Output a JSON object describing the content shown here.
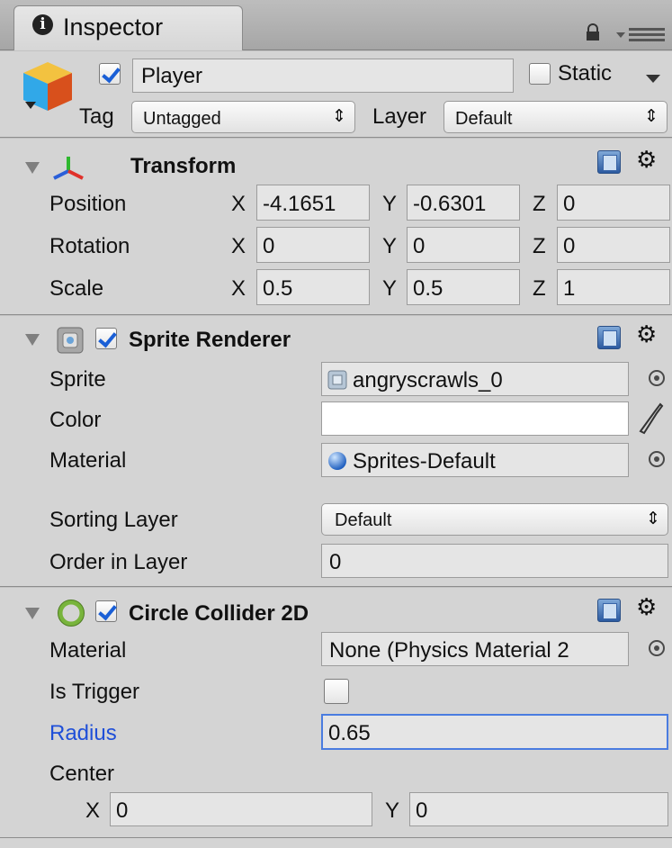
{
  "tab": {
    "title": "Inspector",
    "info_glyph": "i"
  },
  "header": {
    "icon": "cube-icon",
    "name": "Player",
    "active": true,
    "static_label": "Static",
    "static_checked": false,
    "tag_label": "Tag",
    "tag_value": "Untagged",
    "layer_label": "Layer",
    "layer_value": "Default"
  },
  "transform": {
    "title": "Transform",
    "rows": [
      {
        "label": "Position",
        "x": "-4.1651",
        "y": "-0.6301",
        "z": "0"
      },
      {
        "label": "Rotation",
        "x": "0",
        "y": "0",
        "z": "0"
      },
      {
        "label": "Scale",
        "x": "0.5",
        "y": "0.5",
        "z": "1"
      }
    ],
    "axis_x": "X",
    "axis_y": "Y",
    "axis_z": "Z"
  },
  "sprite_renderer": {
    "title": "Sprite Renderer",
    "enabled": true,
    "sprite_label": "Sprite",
    "sprite_value": "angryscrawls_0",
    "color_label": "Color",
    "color_value": "#ffffff",
    "material_label": "Material",
    "material_value": "Sprites-Default",
    "sorting_layer_label": "Sorting Layer",
    "sorting_layer_value": "Default",
    "order_label": "Order in Layer",
    "order_value": "0"
  },
  "circle_collider": {
    "title": "Circle Collider 2D",
    "enabled": true,
    "material_label": "Material",
    "material_value": "None (Physics Material 2",
    "is_trigger_label": "Is Trigger",
    "is_trigger": false,
    "radius_label": "Radius",
    "radius_value": "0.65",
    "center_label": "Center",
    "center_x_label": "X",
    "center_x": "0",
    "center_y_label": "Y",
    "center_y": "0"
  },
  "colors": {
    "accent": "#1f4fd8",
    "panel": "#d4d4d4",
    "field": "#e5e5e5"
  }
}
